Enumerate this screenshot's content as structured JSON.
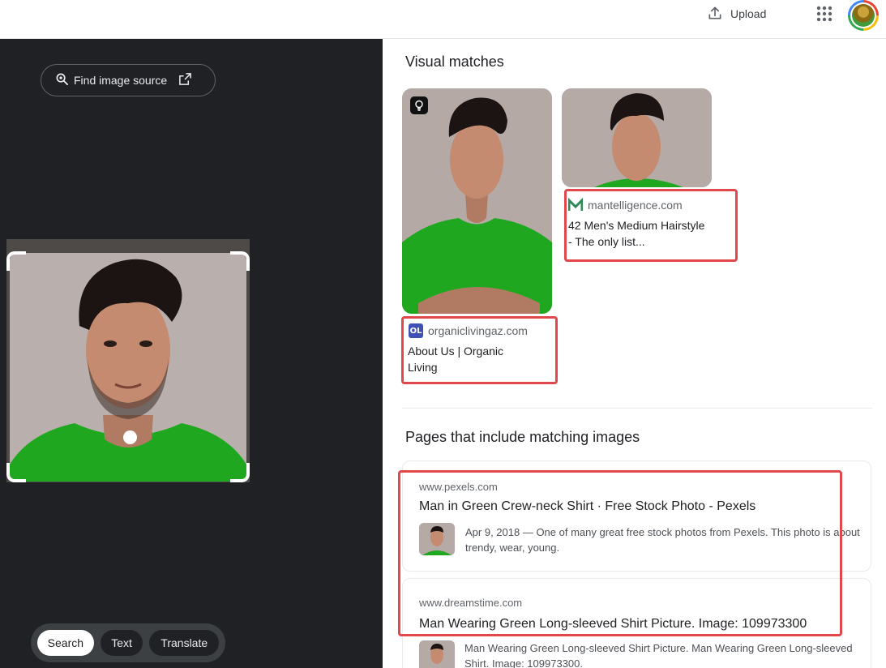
{
  "header": {
    "upload_label": "Upload",
    "icons": {
      "upload": "upload-icon",
      "apps": "apps-grid-icon",
      "avatar": "account-avatar"
    }
  },
  "left_panel": {
    "find_source_label": "Find image source",
    "modes": [
      "Search",
      "Text",
      "Translate"
    ],
    "active_mode": "Search"
  },
  "visual_matches": {
    "heading": "Visual matches",
    "items": [
      {
        "site": "organiclivingaz.com",
        "favicon_text": "OL",
        "title": "About Us | Organic Living"
      },
      {
        "site": "mantelligence.com",
        "favicon_text": "M",
        "title": "42 Men's Medium Hairstyle - The only list..."
      }
    ]
  },
  "pages": {
    "heading": "Pages that include matching images",
    "items": [
      {
        "site": "www.pexels.com",
        "title": "Man in Green Crew-neck Shirt · Free Stock Photo - Pexels",
        "snippet": "Apr 9, 2018 — One of many great free stock photos from Pexels. This photo is about trendy, wear, young."
      },
      {
        "site": "www.dreamstime.com",
        "title": "Man Wearing Green Long-sleeved Shirt Picture. Image: 109973300",
        "snippet": "Man Wearing Green Long-sleeved Shirt Picture. Man Wearing Green Long-sleeved Shirt. Image: 109973300."
      }
    ]
  },
  "colors": {
    "highlight": "#e2474b",
    "dark_panel": "#202124",
    "shirt_green": "#1fa81f"
  }
}
